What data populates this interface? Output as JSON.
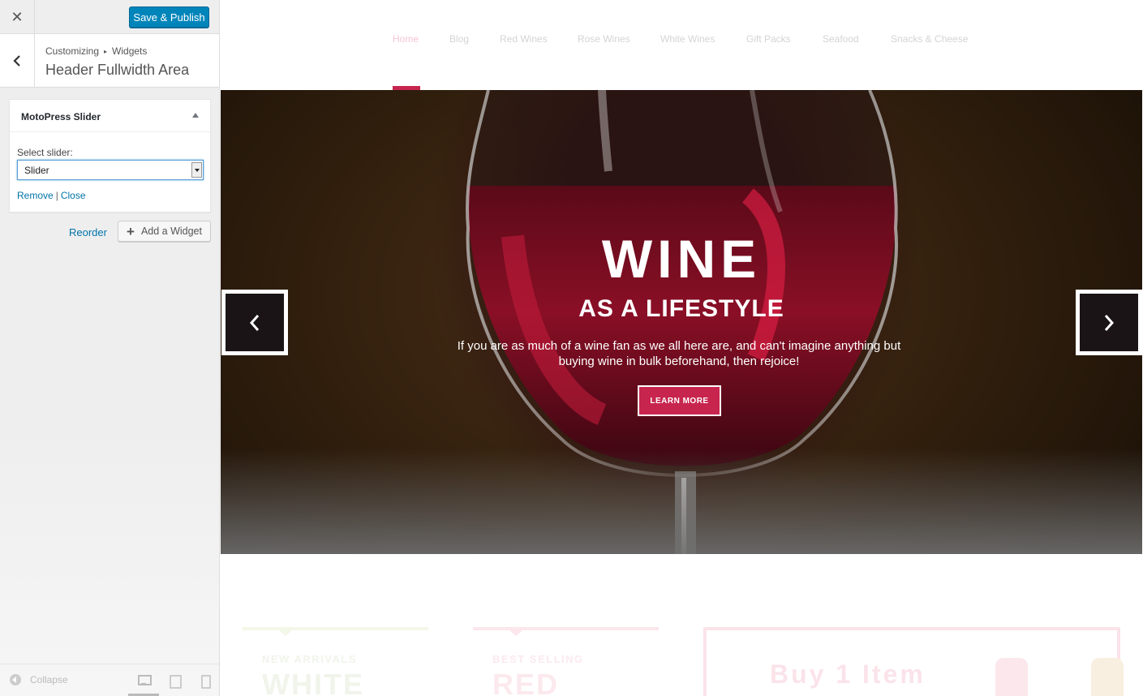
{
  "customizer": {
    "close_icon": "close-icon",
    "publish_label": "Save & Publish",
    "breadcrumb": {
      "root": "Customizing",
      "separator": "▸",
      "section": "Widgets"
    },
    "panel_title": "Header Fullwidth Area",
    "widget": {
      "title": "MotoPress Slider",
      "select_label": "Select slider:",
      "selected_value": "Slider",
      "remove_label": "Remove",
      "separator": "|",
      "close_label": "Close"
    },
    "reorder_label": "Reorder",
    "add_widget_label": "Add a Widget",
    "footer": {
      "collapse_label": "Collapse"
    },
    "accent_color": "#0085ba"
  },
  "preview": {
    "nav": {
      "items": [
        {
          "label": "Home",
          "active": true
        },
        {
          "label": "Blog"
        },
        {
          "label": "Red Wines"
        },
        {
          "label": "Rose Wines"
        },
        {
          "label": "White Wines"
        },
        {
          "label": "Gift Packs"
        },
        {
          "label": "Seafood"
        },
        {
          "label": "Snacks & Cheese"
        }
      ]
    },
    "hero": {
      "title": "WINE",
      "subtitle": "AS A LIFESTYLE",
      "text": "If you are as much of a wine fan as we all here are, and can't imagine anything but buying wine in bulk beforehand, then rejoice!",
      "button_label": "LEARN MORE",
      "accent_color": "#c7254e"
    },
    "promos": {
      "new_arrivals_caption": "NEW ARRIVALS",
      "new_arrivals_title": "WHITE",
      "best_selling_caption": "BEST SELLING",
      "best_selling_title": "RED",
      "buy_text": "Buy 1 Item"
    }
  }
}
